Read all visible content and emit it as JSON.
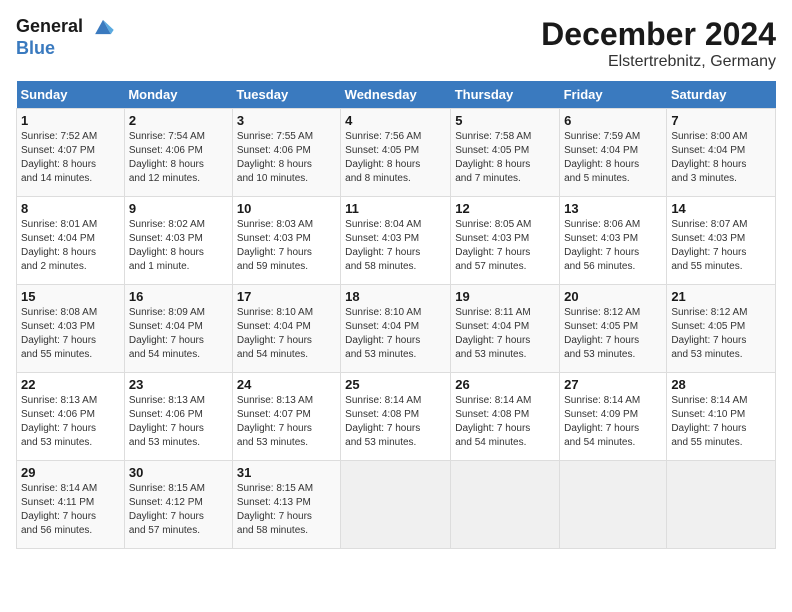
{
  "header": {
    "logo_line1": "General",
    "logo_line2": "Blue",
    "month": "December 2024",
    "location": "Elstertrebnitz, Germany"
  },
  "weekdays": [
    "Sunday",
    "Monday",
    "Tuesday",
    "Wednesday",
    "Thursday",
    "Friday",
    "Saturday"
  ],
  "weeks": [
    [
      {
        "day": "1",
        "info": "Sunrise: 7:52 AM\nSunset: 4:07 PM\nDaylight: 8 hours\nand 14 minutes."
      },
      {
        "day": "2",
        "info": "Sunrise: 7:54 AM\nSunset: 4:06 PM\nDaylight: 8 hours\nand 12 minutes."
      },
      {
        "day": "3",
        "info": "Sunrise: 7:55 AM\nSunset: 4:06 PM\nDaylight: 8 hours\nand 10 minutes."
      },
      {
        "day": "4",
        "info": "Sunrise: 7:56 AM\nSunset: 4:05 PM\nDaylight: 8 hours\nand 8 minutes."
      },
      {
        "day": "5",
        "info": "Sunrise: 7:58 AM\nSunset: 4:05 PM\nDaylight: 8 hours\nand 7 minutes."
      },
      {
        "day": "6",
        "info": "Sunrise: 7:59 AM\nSunset: 4:04 PM\nDaylight: 8 hours\nand 5 minutes."
      },
      {
        "day": "7",
        "info": "Sunrise: 8:00 AM\nSunset: 4:04 PM\nDaylight: 8 hours\nand 3 minutes."
      }
    ],
    [
      {
        "day": "8",
        "info": "Sunrise: 8:01 AM\nSunset: 4:04 PM\nDaylight: 8 hours\nand 2 minutes."
      },
      {
        "day": "9",
        "info": "Sunrise: 8:02 AM\nSunset: 4:03 PM\nDaylight: 8 hours\nand 1 minute."
      },
      {
        "day": "10",
        "info": "Sunrise: 8:03 AM\nSunset: 4:03 PM\nDaylight: 7 hours\nand 59 minutes."
      },
      {
        "day": "11",
        "info": "Sunrise: 8:04 AM\nSunset: 4:03 PM\nDaylight: 7 hours\nand 58 minutes."
      },
      {
        "day": "12",
        "info": "Sunrise: 8:05 AM\nSunset: 4:03 PM\nDaylight: 7 hours\nand 57 minutes."
      },
      {
        "day": "13",
        "info": "Sunrise: 8:06 AM\nSunset: 4:03 PM\nDaylight: 7 hours\nand 56 minutes."
      },
      {
        "day": "14",
        "info": "Sunrise: 8:07 AM\nSunset: 4:03 PM\nDaylight: 7 hours\nand 55 minutes."
      }
    ],
    [
      {
        "day": "15",
        "info": "Sunrise: 8:08 AM\nSunset: 4:03 PM\nDaylight: 7 hours\nand 55 minutes."
      },
      {
        "day": "16",
        "info": "Sunrise: 8:09 AM\nSunset: 4:04 PM\nDaylight: 7 hours\nand 54 minutes."
      },
      {
        "day": "17",
        "info": "Sunrise: 8:10 AM\nSunset: 4:04 PM\nDaylight: 7 hours\nand 54 minutes."
      },
      {
        "day": "18",
        "info": "Sunrise: 8:10 AM\nSunset: 4:04 PM\nDaylight: 7 hours\nand 53 minutes."
      },
      {
        "day": "19",
        "info": "Sunrise: 8:11 AM\nSunset: 4:04 PM\nDaylight: 7 hours\nand 53 minutes."
      },
      {
        "day": "20",
        "info": "Sunrise: 8:12 AM\nSunset: 4:05 PM\nDaylight: 7 hours\nand 53 minutes."
      },
      {
        "day": "21",
        "info": "Sunrise: 8:12 AM\nSunset: 4:05 PM\nDaylight: 7 hours\nand 53 minutes."
      }
    ],
    [
      {
        "day": "22",
        "info": "Sunrise: 8:13 AM\nSunset: 4:06 PM\nDaylight: 7 hours\nand 53 minutes."
      },
      {
        "day": "23",
        "info": "Sunrise: 8:13 AM\nSunset: 4:06 PM\nDaylight: 7 hours\nand 53 minutes."
      },
      {
        "day": "24",
        "info": "Sunrise: 8:13 AM\nSunset: 4:07 PM\nDaylight: 7 hours\nand 53 minutes."
      },
      {
        "day": "25",
        "info": "Sunrise: 8:14 AM\nSunset: 4:08 PM\nDaylight: 7 hours\nand 53 minutes."
      },
      {
        "day": "26",
        "info": "Sunrise: 8:14 AM\nSunset: 4:08 PM\nDaylight: 7 hours\nand 54 minutes."
      },
      {
        "day": "27",
        "info": "Sunrise: 8:14 AM\nSunset: 4:09 PM\nDaylight: 7 hours\nand 54 minutes."
      },
      {
        "day": "28",
        "info": "Sunrise: 8:14 AM\nSunset: 4:10 PM\nDaylight: 7 hours\nand 55 minutes."
      }
    ],
    [
      {
        "day": "29",
        "info": "Sunrise: 8:14 AM\nSunset: 4:11 PM\nDaylight: 7 hours\nand 56 minutes."
      },
      {
        "day": "30",
        "info": "Sunrise: 8:15 AM\nSunset: 4:12 PM\nDaylight: 7 hours\nand 57 minutes."
      },
      {
        "day": "31",
        "info": "Sunrise: 8:15 AM\nSunset: 4:13 PM\nDaylight: 7 hours\nand 58 minutes."
      },
      null,
      null,
      null,
      null
    ]
  ]
}
